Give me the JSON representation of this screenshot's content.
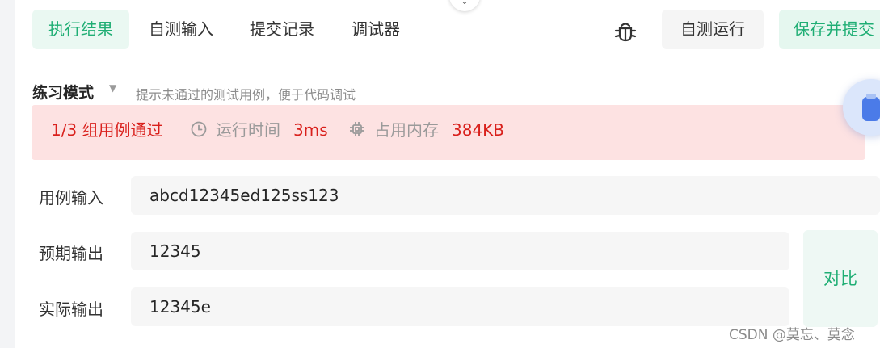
{
  "tabs": [
    {
      "label": "执行结果",
      "active": true
    },
    {
      "label": "自测输入",
      "active": false
    },
    {
      "label": "提交记录",
      "active": false
    },
    {
      "label": "调试器",
      "active": false
    }
  ],
  "toolbar": {
    "run_label": "自测运行",
    "submit_label": "保存并提交"
  },
  "mode": {
    "label": "练习模式",
    "hint": "提示未通过的测试用例，便于代码调试"
  },
  "result": {
    "passed_text": "1/3 组用例通过",
    "time_label": "运行时间",
    "time_value": "3ms",
    "memory_label": "占用内存",
    "memory_value": "384KB"
  },
  "io": {
    "input_label": "用例输入",
    "input_value": "abcd12345ed125ss123",
    "expected_label": "预期输出",
    "expected_value": "12345",
    "actual_label": "实际输出",
    "actual_value": "12345e"
  },
  "compare_label": "对比",
  "watermark": "CSDN @莫忘、莫念",
  "colors": {
    "accent": "#1fae74",
    "error": "#d9201c",
    "error_bg": "#fde2e2"
  },
  "icons": [
    "chevron-down-icon",
    "bug-icon",
    "caret-down-icon",
    "clock-icon",
    "chip-icon",
    "assistant-icon"
  ]
}
